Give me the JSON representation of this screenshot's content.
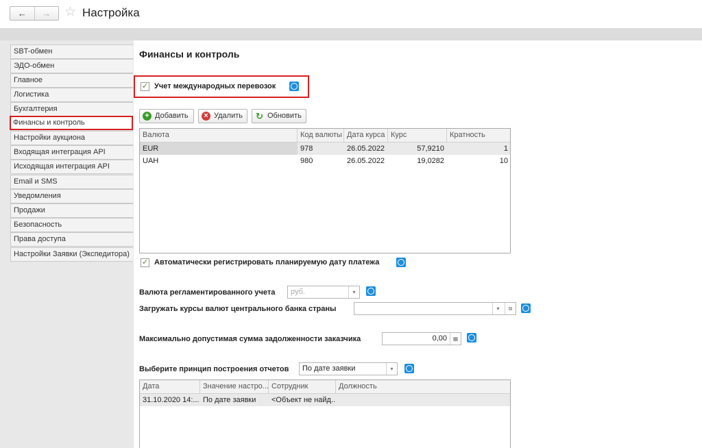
{
  "window": {
    "title": "Настройка",
    "back_glyph": "←",
    "forward_glyph": "→",
    "star_glyph": "☆"
  },
  "sidebar": {
    "items": [
      "SBT-обмен",
      "ЭДО-обмен",
      "Главное",
      "Логистика",
      "Бухгалтерия",
      "Финансы и контроль",
      "Настройки аукциона",
      "Входящая интеграция API",
      "Исходящая интеграция API",
      "Email и SMS",
      "Уведомления",
      "Продажи",
      "Безопасность",
      "Права доступа",
      "Настройки Заявки (Экспедитора)"
    ],
    "active": "Финансы и контроль"
  },
  "main": {
    "title": "Финансы и контроль",
    "intl_checkbox": {
      "label": "Учет международных перевозок",
      "checked": true
    },
    "buttons": {
      "add": "Добавить",
      "delete": "Удалить",
      "refresh": "Обновить"
    },
    "currency_table": {
      "columns": [
        "Валюта",
        "Код валюты",
        "Дата курса",
        "Курс",
        "Кратность"
      ],
      "rows": [
        [
          "EUR",
          "978",
          "26.05.2022",
          "57,9210",
          "1"
        ],
        [
          "UAH",
          "980",
          "26.05.2022",
          "19,0282",
          "10"
        ]
      ]
    },
    "auto_date": {
      "label": "Автоматически регистрировать планируемую дату платежа",
      "checked": true
    },
    "reg_currency": {
      "label": "Валюта регламентированного учета",
      "value": "руб."
    },
    "cb_rates": {
      "label": "Загружать курсы валют центрального банка страны",
      "value": ""
    },
    "max_debt": {
      "label": "Максимально допустимая сумма задолженности заказчика",
      "value": "0,00"
    },
    "report_principle": {
      "label": "Выберите принцип построения отчетов",
      "value": "По дате заявки"
    },
    "history_table": {
      "columns": [
        "Дата",
        "Значение настро...",
        "Сотрудник",
        "Должность"
      ],
      "rows": [
        [
          "31.10.2020 14:...",
          "По дате заявки",
          "<Объект не найд...",
          ""
        ]
      ]
    }
  },
  "colors": {
    "accent_red": "#d61f1f",
    "help_blue": "#1c8ee0",
    "check_green": "#5a7e2a"
  }
}
